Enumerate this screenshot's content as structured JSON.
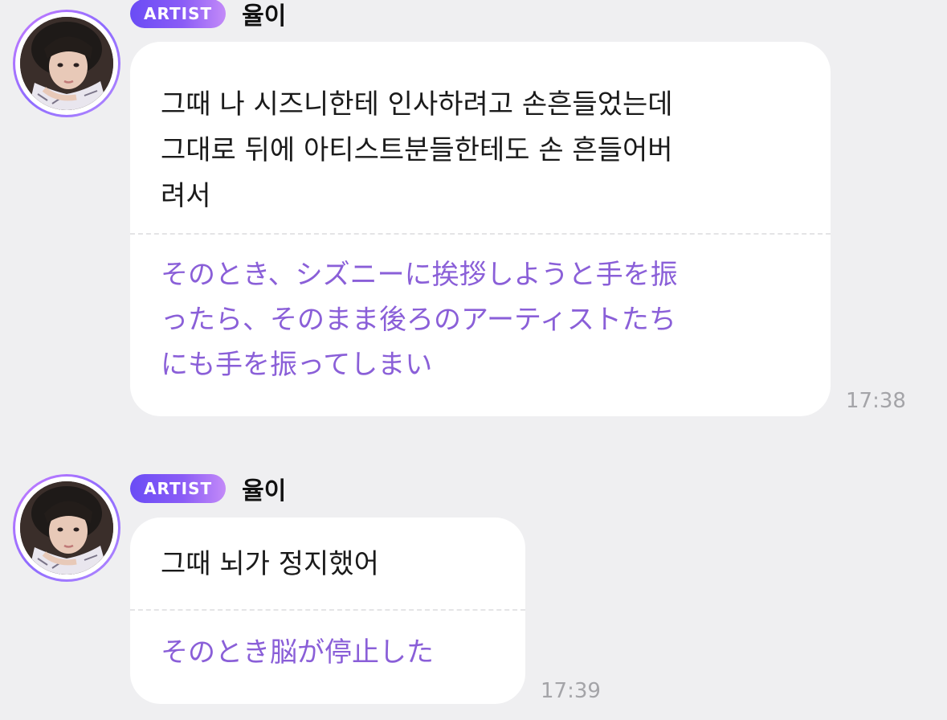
{
  "messages": [
    {
      "badge": "ARTIST",
      "sender": "율이",
      "original_lines": [
        "그때 나 시즈니한테 인사하려고 손흔들었는데",
        "그대로 뒤에 아티스트분들한테도 손 흔들어버",
        "려서"
      ],
      "translation_lines": [
        "そのとき、シズニーに挨拶しようと手を振",
        "ったら、そのまま後ろのアーティストたち",
        "にも手を振ってしまい"
      ],
      "time": "17:38"
    },
    {
      "badge": "ARTIST",
      "sender": "율이",
      "original_lines": [
        "그때 뇌가 정지했어"
      ],
      "translation_lines": [
        "そのとき脳が停止した"
      ],
      "time": "17:39"
    }
  ],
  "colors": {
    "background": "#efeff1",
    "bubble": "#ffffff",
    "translation_text": "#8a5fd8",
    "badge_start": "#6a4cf5",
    "badge_end": "#c38af8",
    "timestamp": "#a4a4a8"
  }
}
